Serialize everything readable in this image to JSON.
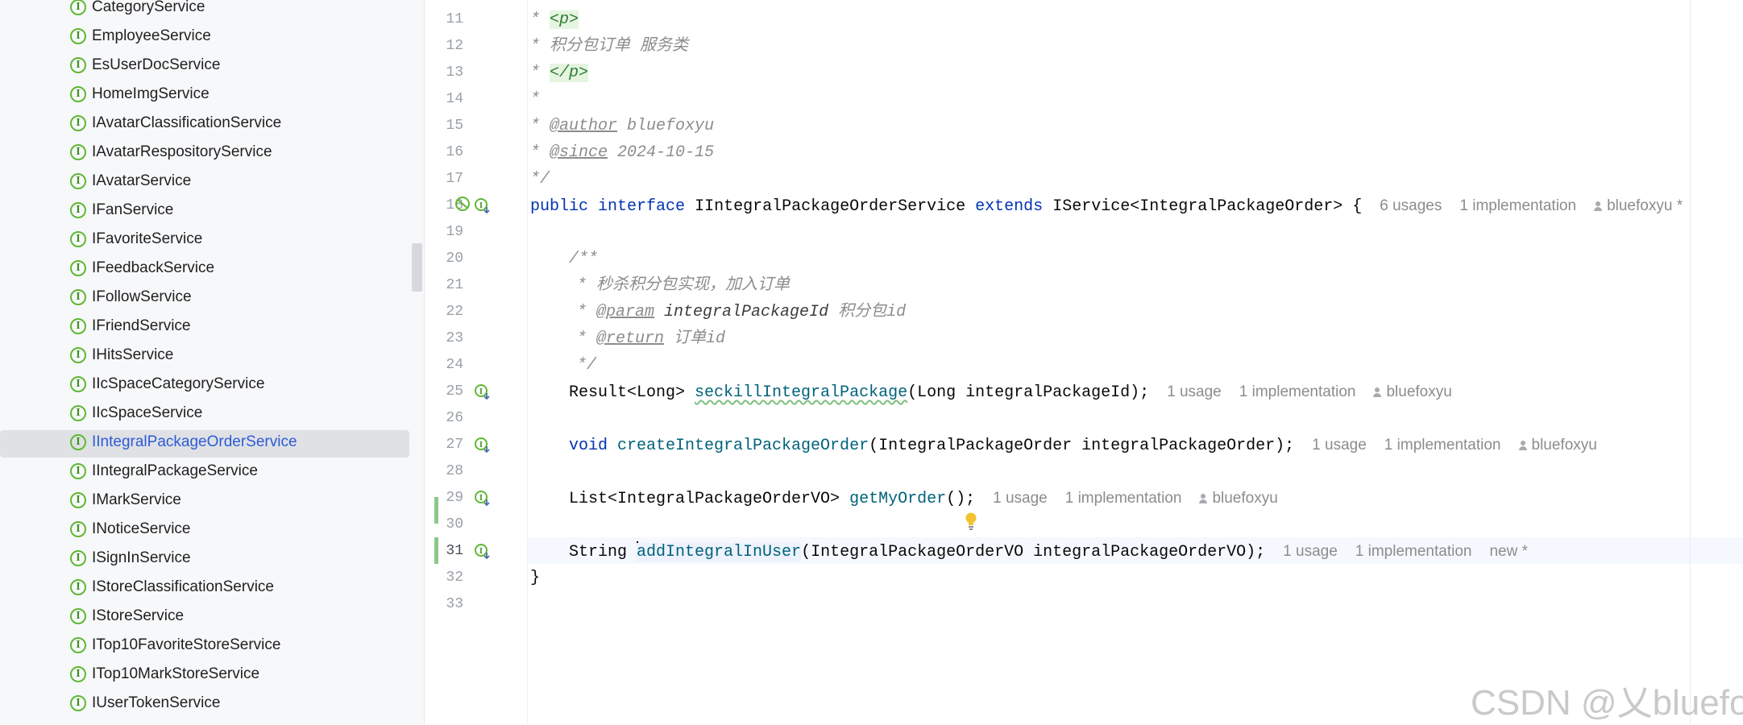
{
  "project_tree": {
    "items": [
      {
        "label": "CategoryService",
        "selected": false
      },
      {
        "label": "EmployeeService",
        "selected": false
      },
      {
        "label": "EsUserDocService",
        "selected": false
      },
      {
        "label": "HomeImgService",
        "selected": false
      },
      {
        "label": "IAvatarClassificationService",
        "selected": false
      },
      {
        "label": "IAvatarRespositoryService",
        "selected": false
      },
      {
        "label": "IAvatarService",
        "selected": false
      },
      {
        "label": "IFanService",
        "selected": false
      },
      {
        "label": "IFavoriteService",
        "selected": false
      },
      {
        "label": "IFeedbackService",
        "selected": false
      },
      {
        "label": "IFollowService",
        "selected": false
      },
      {
        "label": "IFriendService",
        "selected": false
      },
      {
        "label": "IHitsService",
        "selected": false
      },
      {
        "label": "IIcSpaceCategoryService",
        "selected": false
      },
      {
        "label": "IIcSpaceService",
        "selected": false
      },
      {
        "label": "IIntegralPackageOrderService",
        "selected": true
      },
      {
        "label": "IIntegralPackageService",
        "selected": false
      },
      {
        "label": "IMarkService",
        "selected": false
      },
      {
        "label": "INoticeService",
        "selected": false
      },
      {
        "label": "ISignInService",
        "selected": false
      },
      {
        "label": "IStoreClassificationService",
        "selected": false
      },
      {
        "label": "IStoreService",
        "selected": false
      },
      {
        "label": "ITop10FavoriteStoreService",
        "selected": false
      },
      {
        "label": "ITop10MarkStoreService",
        "selected": false
      },
      {
        "label": "IUserTokenService",
        "selected": false
      }
    ],
    "item_icon": "interface-icon"
  },
  "editor": {
    "line_numbers": [
      "11",
      "12",
      "13",
      "14",
      "15",
      "16",
      "17",
      "18",
      "19",
      "20",
      "21",
      "22",
      "23",
      "24",
      "25",
      "26",
      "27",
      "28",
      "29",
      "30",
      "31",
      "32",
      "33"
    ],
    "current_line": "31",
    "lines": {
      "l11": {
        "star": "* ",
        "tag": "<p>"
      },
      "l12": {
        "text": "* 积分包订单 服务类"
      },
      "l13": {
        "star": "* ",
        "tag": "</p>"
      },
      "l14": {
        "text": "*"
      },
      "l15": {
        "star": "* ",
        "tag": "@author",
        "value": " bluefoxyu"
      },
      "l16": {
        "star": "* ",
        "tag": "@since",
        "value": " 2024-10-15"
      },
      "l17": {
        "text": "*/"
      },
      "l18": {
        "kw1": "public",
        "kw2": "interface",
        "name": "IIntegralPackageOrderService",
        "kw3": "extends",
        "rest": "IService<IntegralPackageOrder> {",
        "usages": "6 usages",
        "impl": "1 implementation",
        "author": "bluefoxyu *"
      },
      "l20": {
        "text": "/**"
      },
      "l21": {
        "text": "* 秒杀积分包实现，加入订单"
      },
      "l22": {
        "star": "* ",
        "tag": "@param",
        "param": " integralPackageId",
        "desc": " 积分包id"
      },
      "l23": {
        "star": "* ",
        "tag": "@return",
        "desc": " 订单id"
      },
      "l24": {
        "text": "*/"
      },
      "l25": {
        "type": "Result<Long> ",
        "method": "seckillIntegralPackage",
        "args": "(Long integralPackageId);",
        "usages": "1 usage",
        "impl": "1 implementation",
        "author": "bluefoxyu"
      },
      "l27": {
        "type": "void ",
        "method": "createIntegralPackageOrder",
        "args": "(IntegralPackageOrder integralPackageOrder);",
        "usages": "1 usage",
        "impl": "1 implementation",
        "author": "bluefoxyu"
      },
      "l29": {
        "type": "List<IntegralPackageOrderVO> ",
        "method": "getMyOrder",
        "args": "();",
        "usages": "1 usage",
        "impl": "1 implementation",
        "author": "bluefoxyu"
      },
      "l31": {
        "type": "String ",
        "method": "addIntegralInUser",
        "args": "(IntegralPackageOrderVO integralPackageOrderVO);",
        "usages": "1 usage",
        "impl": "1 implementation",
        "author": "new *"
      },
      "l32": {
        "text": "}"
      }
    },
    "gutter_icons": {
      "l18": [
        "no-implementation-icon",
        "implemented-interface-icon"
      ],
      "l25": [
        "implemented-method-icon"
      ],
      "l27": [
        "implemented-method-icon"
      ],
      "l29": [
        "implemented-method-icon"
      ],
      "l31": [
        "implemented-method-icon"
      ]
    },
    "intention_icon": "lightbulb-icon"
  },
  "watermark": "CSDN @乂bluefox",
  "colors": {
    "keyword": "#0033b3",
    "method": "#00627a",
    "comment": "#8c8c8c",
    "selected_tree_text": "#2e5bd6",
    "change_bar": "#8bc98a",
    "tree_bg": "#f7f8fa"
  }
}
